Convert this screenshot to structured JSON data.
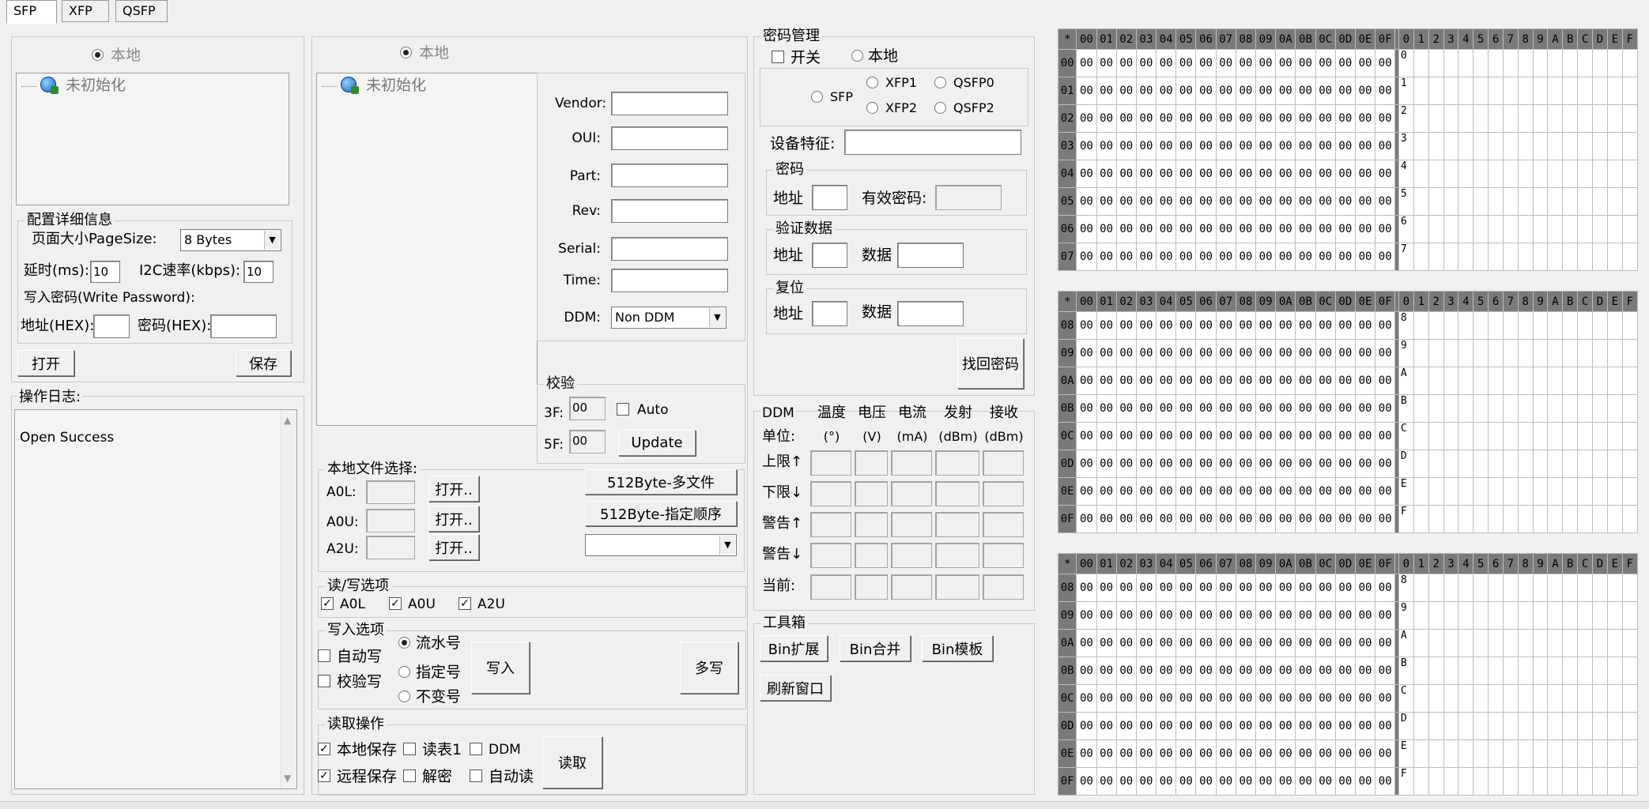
{
  "tabs": [
    "SFP",
    "XFP",
    "QSFP"
  ],
  "left_tree": {
    "radio_label": "本地",
    "node": "未初始化"
  },
  "config": {
    "title": "配置详细信息",
    "page_size_label": "页面大小PageSize:",
    "page_size_value": "8  Bytes",
    "delay_label": "延时(ms):",
    "delay_value": "10",
    "i2c_label": "I2C速率(kbps):",
    "i2c_value": "10",
    "write_pw_label": "写入密码(Write Password):",
    "addr_label": "地址(HEX):",
    "pw_label": "密码(HEX):",
    "open_button": "打开",
    "save_button": "保存"
  },
  "log": {
    "title": "操作日志:",
    "lines": [
      "Open Success"
    ]
  },
  "remote_tree": {
    "radio_label": "本地",
    "node": "未初始化"
  },
  "info": {
    "vendor": "Vendor:",
    "oui": "OUI:",
    "part": "Part:",
    "rev": "Rev:",
    "serial": "Serial:",
    "time": "Time:",
    "ddm": "DDM:",
    "ddm_value": "Non DDM"
  },
  "checksum": {
    "title": "校验",
    "f3_label": "3F:",
    "f3_value": "00",
    "f5_label": "5F:",
    "f5_value": "00",
    "auto_label": "Auto",
    "update_button": "Update"
  },
  "local_files": {
    "title": "本地文件选择:",
    "a0l": "A0L:",
    "a0u": "A0U:",
    "a2u": "A2U:",
    "open_button": "打开..",
    "multi_file_button": "512Byte-多文件",
    "order_button": "512Byte-指定顺序"
  },
  "rw_options": {
    "title": "读/写选项",
    "a0l": "A0L",
    "a0u": "A0U",
    "a2u": "A2U"
  },
  "write_options": {
    "title": "写入选项",
    "auto_write": "自动写",
    "verify_write": "校验写",
    "serial_no": "流水号",
    "specified_no": "指定号",
    "unchanged_no": "不变号",
    "write_button": "写入",
    "multi_write_button": "多写"
  },
  "read_ops": {
    "title": "读取操作",
    "local_save": "本地保存",
    "read_table1": "读表1",
    "ddm": "DDM",
    "remote_save": "远程保存",
    "decrypt": "解密",
    "auto_read": "自动读",
    "read_button": "读取"
  },
  "password_mgmt": {
    "title": "密码管理",
    "switch": "开关",
    "local": "本地",
    "sfp": "SFP",
    "xfp1": "XFP1",
    "xfp2": "XFP2",
    "qsfp0": "QSFP0",
    "qsfp2": "QSFP2",
    "device_feature": "设备特征:",
    "pw_group": "密码",
    "addr": "地址",
    "valid_pw": "有效密码:",
    "verify_group": "验证数据",
    "data": "数据",
    "reset_group": "复位",
    "recover_button": "找回密码"
  },
  "ddm": {
    "title": "DDM",
    "cols": [
      "温度",
      "电压",
      "电流",
      "发射",
      "接收"
    ],
    "units_label": "单位:",
    "units": [
      "(°)",
      "(V)",
      "(mA)",
      "(dBm)",
      "(dBm)"
    ],
    "rows": [
      "上限↑",
      "下限↓",
      "警告↑",
      "警告↓",
      "当前:"
    ]
  },
  "toolbox": {
    "title": "工具箱",
    "bin_expand": "Bin扩展",
    "bin_merge": "Bin合并",
    "bin_template": "Bin模板",
    "refresh": "刷新窗口"
  },
  "hex": {
    "corner": "*",
    "cols": [
      "00",
      "01",
      "02",
      "03",
      "04",
      "05",
      "06",
      "07",
      "08",
      "09",
      "0A",
      "0B",
      "0C",
      "0D",
      "0E",
      "0F"
    ],
    "ascii_cols": [
      "0",
      "1",
      "2",
      "3",
      "4",
      "5",
      "6",
      "7",
      "8",
      "9",
      "A",
      "B",
      "C",
      "D",
      "E",
      "F"
    ],
    "cell": "00",
    "tables": [
      {
        "rows": [
          "00",
          "01",
          "02",
          "03",
          "04",
          "05",
          "06",
          "07"
        ],
        "ascii_rows": [
          "0",
          "1",
          "2",
          "3",
          "4",
          "5",
          "6",
          "7"
        ]
      },
      {
        "rows": [
          "08",
          "09",
          "0A",
          "0B",
          "0C",
          "0D",
          "0E",
          "0F"
        ],
        "ascii_rows": [
          "8",
          "9",
          "A",
          "B",
          "C",
          "D",
          "E",
          "F"
        ]
      },
      {
        "rows": [
          "08",
          "09",
          "0A",
          "0B",
          "0C",
          "0D",
          "0E",
          "0F"
        ],
        "ascii_rows": [
          "8",
          "9",
          "A",
          "B",
          "C",
          "D",
          "E",
          "F"
        ]
      }
    ]
  }
}
